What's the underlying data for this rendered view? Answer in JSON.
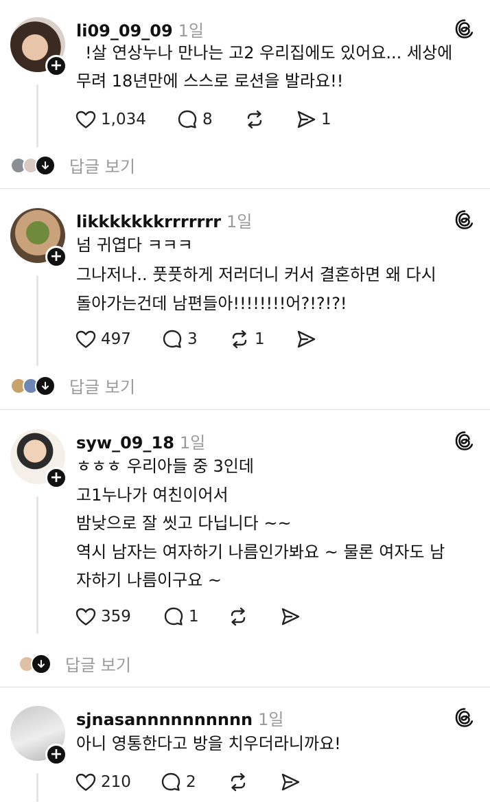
{
  "posts": [
    {
      "username": "li09_09_09",
      "time": "1일",
      "lines": [
        "!살 연상누나 만나는 고2 우리집에도 있어요... 세상에",
        "무려 18년만에 스스로 로션을 발라요!!"
      ],
      "likes": "1,034",
      "comments": "8",
      "reposts": "",
      "shares": "1",
      "replies_label": "답글 보기"
    },
    {
      "username": "likkkkkkkrrrrrrr",
      "time": "1일",
      "lines": [
        "넘 귀엽다 ㅋㅋㅋ",
        "그나저나.. 풋풋하게 저러더니 커서 결혼하면 왜 다시",
        "돌아가는건데 남편들아!!!!!!!!어?!?!?!"
      ],
      "likes": "497",
      "comments": "3",
      "reposts": "1",
      "shares": "",
      "replies_label": "답글 보기"
    },
    {
      "username": "syw_09_18",
      "time": "1일",
      "lines": [
        "ㅎㅎㅎ 우리아들 중 3인데",
        "고1누나가 여친이어서",
        "밤낮으로 잘 씻고 다닙니다 ~~",
        "역시 남자는 여자하기 나름인가봐요 ~ 물론 여자도 남",
        "자하기 나름이구요 ~"
      ],
      "likes": "359",
      "comments": "1",
      "reposts": "",
      "shares": "",
      "replies_label": "답글 보기"
    },
    {
      "username": "sjnasannnnnnnnnn",
      "time": "1일",
      "lines": [
        "아니 영통한다고 방을 치우더라니까요!"
      ],
      "likes": "210",
      "comments": "2",
      "reposts": "",
      "shares": ""
    }
  ]
}
